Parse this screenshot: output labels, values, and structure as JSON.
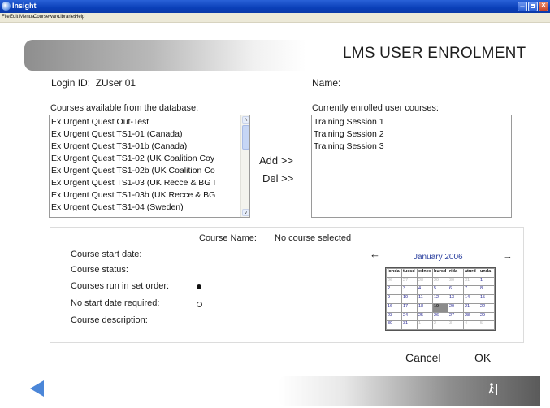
{
  "window": {
    "title": "Insight",
    "menu": [
      "File",
      "Edit",
      "Menus",
      "Courseware",
      "Libraries",
      "Help"
    ]
  },
  "header": {
    "title": "LMS USER ENROLMENT"
  },
  "user": {
    "login_label": "Login ID:",
    "login_value": "ZUser 01",
    "name_label": "Name:",
    "name_value": ""
  },
  "available": {
    "label": "Courses available from the database:",
    "items": [
      "Ex Urgent Quest Out-Test",
      "Ex Urgent Quest TS1-01 (Canada)",
      "Ex Urgent Quest TS1-01b (Canada)",
      "Ex Urgent Quest TS1-02 (UK Coalition Coy",
      "Ex Urgent Quest TS1-02b (UK Coalition Co",
      "Ex Urgent Quest TS1-03 (UK Recce & BG I",
      "Ex Urgent Quest TS1-03b (UK Recce & BG",
      "Ex Urgent Quest TS1-04 (Sweden)"
    ]
  },
  "actions": {
    "add": "Add >>",
    "del": "Del >>"
  },
  "enrolled": {
    "label": "Currently enrolled user courses:",
    "items": [
      "Training Session 1",
      "Training Session 2",
      "Training Session 3"
    ]
  },
  "details": {
    "course_name_label": "Course Name:",
    "course_name_value": "No course selected",
    "start_date_label": "Course start date:",
    "status_label": "Course status:",
    "set_order_label": "Courses run in set order:",
    "set_order_checked": true,
    "no_start_label": "No start date required:",
    "no_start_checked": false,
    "description_label": "Course description:"
  },
  "calendar": {
    "month_label": "January 2006",
    "headers": [
      "londa",
      "tuesd",
      "ednes",
      "hursd",
      "rida",
      "aturd",
      "unda"
    ],
    "weeks": [
      [
        "26",
        "27",
        "28",
        "29",
        "30",
        "31",
        "1"
      ],
      [
        "2",
        "3",
        "4",
        "5",
        "6",
        "7",
        "8"
      ],
      [
        "9",
        "10",
        "11",
        "12",
        "13",
        "14",
        "15"
      ],
      [
        "16",
        "17",
        "18",
        "19",
        "20",
        "21",
        "22"
      ],
      [
        "23",
        "24",
        "25",
        "26",
        "27",
        "28",
        "29"
      ],
      [
        "30",
        "31",
        "1",
        "2",
        "3",
        "4",
        "5"
      ]
    ],
    "selected_day": "19"
  },
  "footer": {
    "cancel": "Cancel",
    "ok": "OK"
  },
  "colors": {
    "accent_blue": "#4b86d8",
    "title_bar": "#0a3fb8"
  }
}
